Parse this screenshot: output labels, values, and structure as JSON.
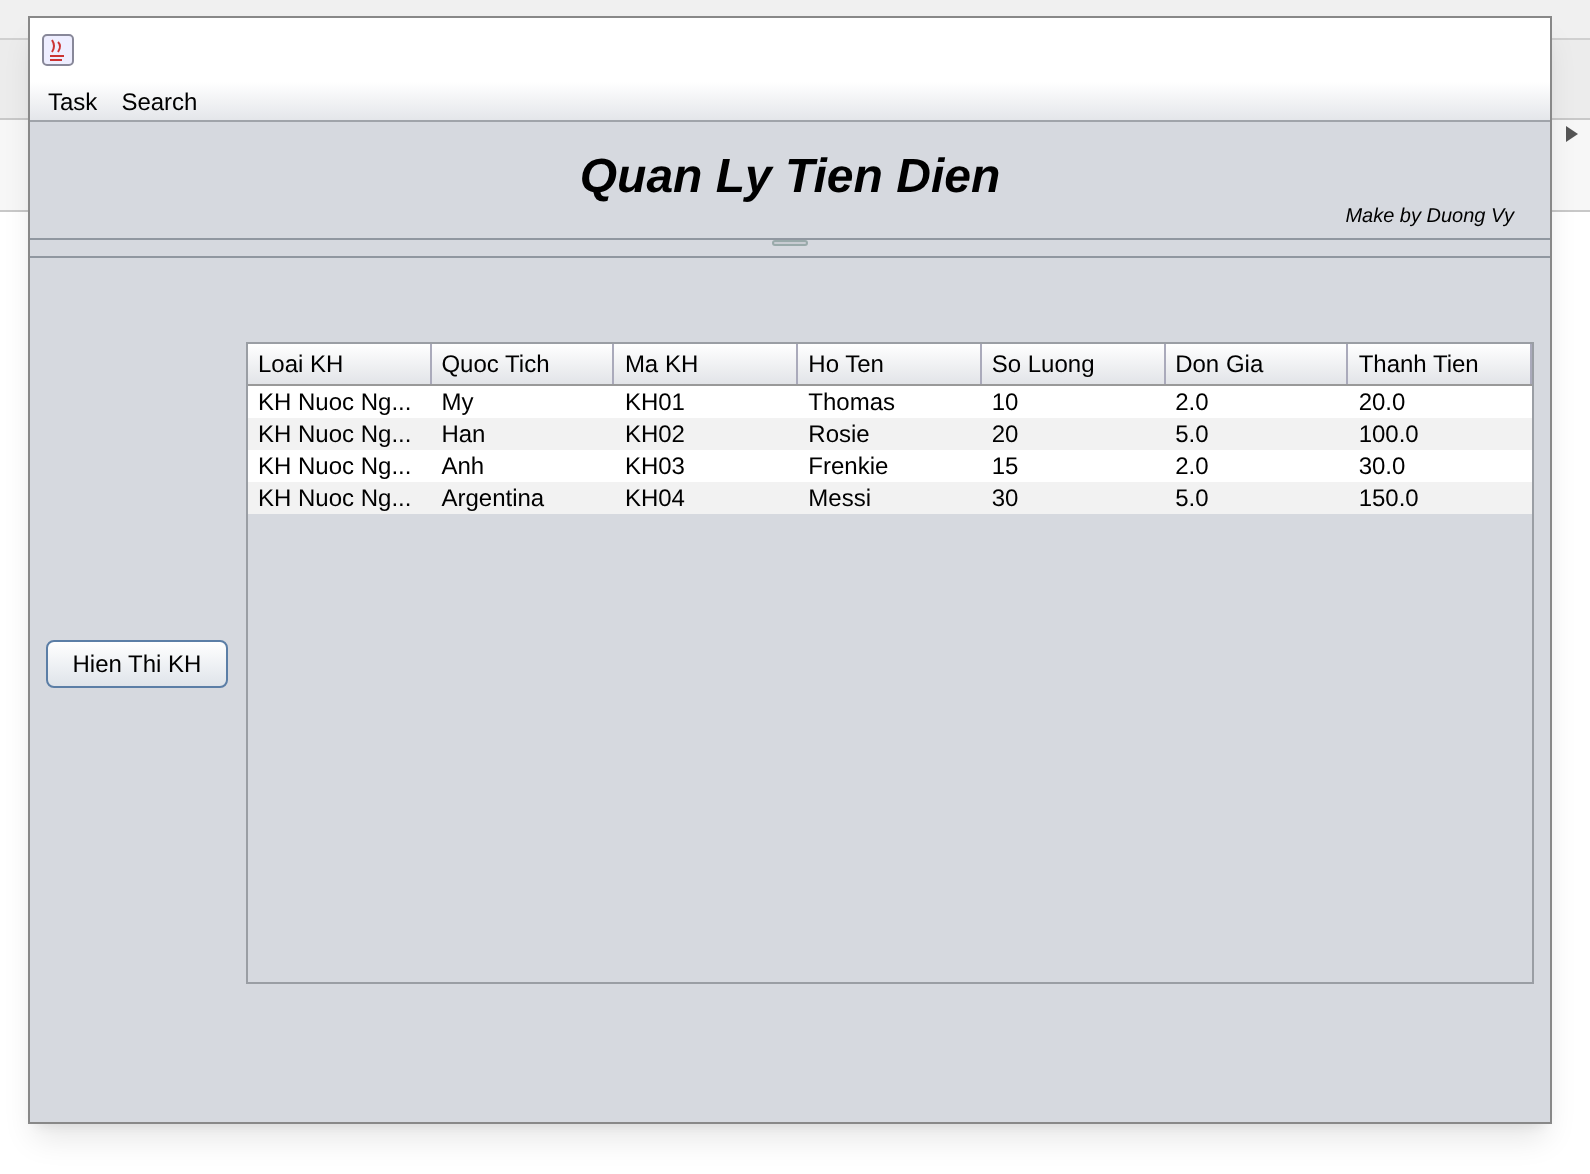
{
  "menu": [
    "Task",
    "Search"
  ],
  "header": {
    "title": "Quan Ly Tien Dien",
    "credit": "Make by Duong Vy"
  },
  "button": "Hien Thi KH",
  "table": {
    "columns": [
      "Loai KH",
      "Quoc Tich",
      "Ma KH",
      "Ho Ten",
      "So Luong",
      "Don Gia",
      "Thanh Tien"
    ],
    "rows": [
      [
        "KH Nuoc Ng...",
        "My",
        "KH01",
        "Thomas",
        "10",
        "2.0",
        "20.0"
      ],
      [
        "KH Nuoc Ng...",
        "Han",
        "KH02",
        "Rosie",
        "20",
        "5.0",
        "100.0"
      ],
      [
        "KH Nuoc Ng...",
        "Anh",
        "KH03",
        "Frenkie",
        "15",
        "2.0",
        "30.0"
      ],
      [
        "KH Nuoc Ng...",
        "Argentina",
        "KH04",
        "Messi",
        "30",
        "5.0",
        "150.0"
      ]
    ]
  }
}
